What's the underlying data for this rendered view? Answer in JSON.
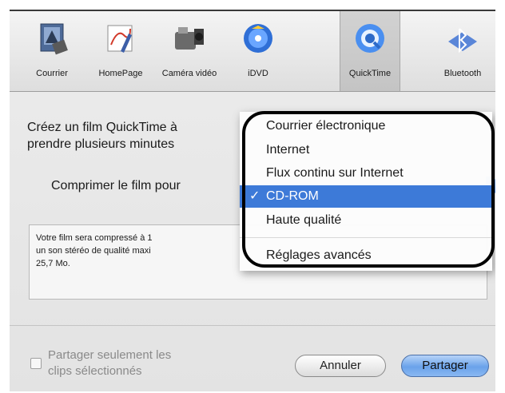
{
  "toolbar": {
    "items": [
      {
        "label": "Courrier",
        "icon": "mail-stamp-icon"
      },
      {
        "label": "HomePage",
        "icon": "homepage-icon"
      },
      {
        "label": "Caméra vidéo",
        "icon": "video-camera-icon"
      },
      {
        "label": "iDVD",
        "icon": "idvd-disc-icon"
      },
      {
        "label": "QuickTime",
        "icon": "quicktime-icon",
        "selected": true
      },
      {
        "label": "Bluetooth",
        "icon": "bluetooth-icon"
      }
    ]
  },
  "pane": {
    "description_line1": "Créez un film QuickTime à",
    "description_line2": "prendre plusieurs minutes",
    "compress_label": "Comprimer le film pour",
    "info_line1": "Votre film sera compressé à 1",
    "info_line2": "un son stéréo de qualité maxi",
    "info_line3": "25,7 Mo."
  },
  "menu": {
    "items": [
      {
        "label": "Courrier électronique"
      },
      {
        "label": "Internet"
      },
      {
        "label": "Flux continu sur Internet"
      },
      {
        "label": "CD-ROM",
        "selected": true,
        "check": "✓"
      },
      {
        "label": "Haute qualité"
      },
      {
        "label": "Réglages avancés"
      }
    ]
  },
  "footer": {
    "checkbox_line1": "Partager seulement les",
    "checkbox_line2": "clips sélectionnés",
    "checkbox_checked": false,
    "cancel_label": "Annuler",
    "share_label": "Partager"
  },
  "colors": {
    "accent": "#3d7ad8",
    "annotation": "#000000"
  }
}
